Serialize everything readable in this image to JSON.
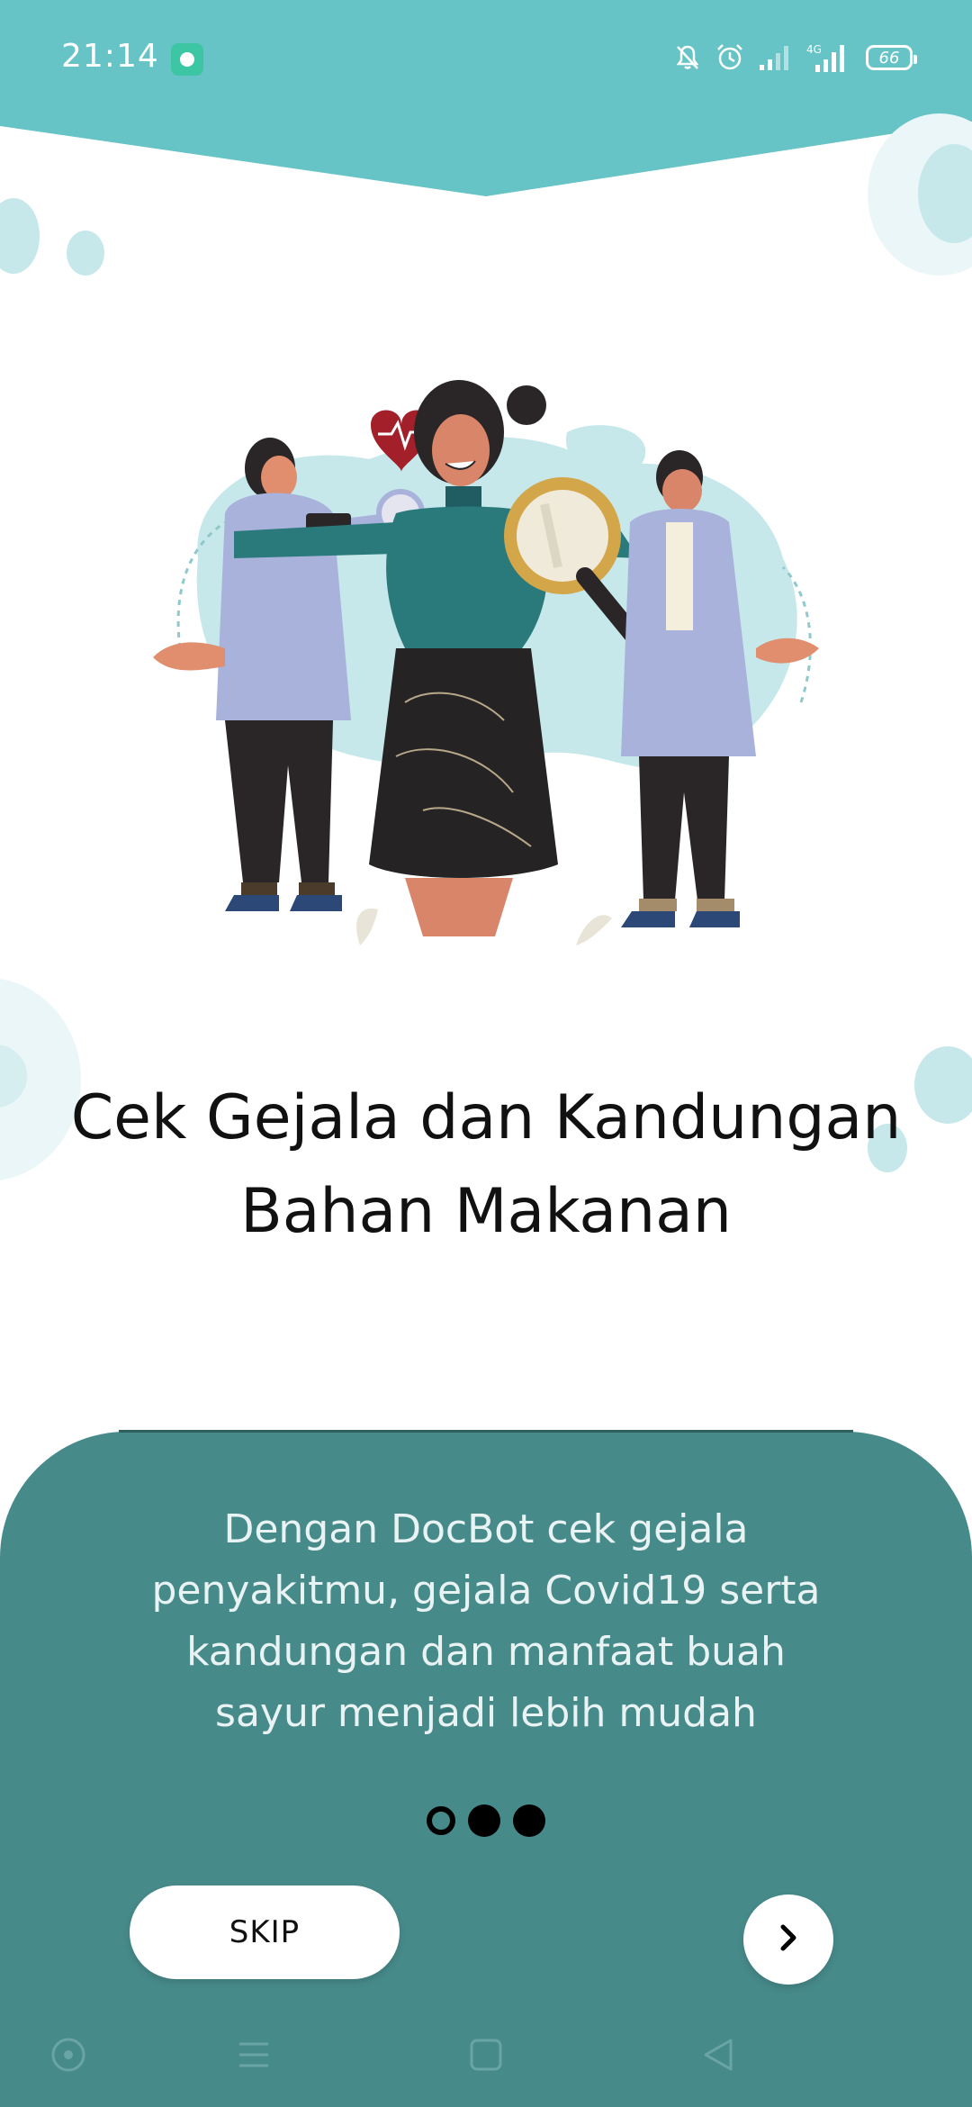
{
  "status_bar": {
    "time": "21:14",
    "battery_level": "66",
    "network_label": "4G",
    "icons": [
      "app-notification-icon",
      "mute-icon",
      "alarm-icon",
      "signal-icon",
      "signal-4g-icon",
      "battery-icon"
    ]
  },
  "onboarding": {
    "headline_line1": "Cek Gejala dan Kandungan",
    "headline_line2": "Bahan Makanan",
    "description_lines": [
      "Dengan DocBot cek gejala",
      "penyakitmu, gejala Covid19 serta",
      "kandungan dan manfaat buah",
      "sayur menjadi lebih mudah"
    ],
    "page_count": 3,
    "current_page": 1
  },
  "buttons": {
    "skip_label": "SKIP",
    "next_icon": "chevron-right-icon"
  },
  "navigation": {
    "items": [
      "assistant-icon",
      "menu-icon",
      "home-square-icon",
      "back-triangle-icon"
    ]
  },
  "colors": {
    "header_teal": "#66c3c6",
    "panel_teal": "#478a8a",
    "bubble_light": "#c6e8ea",
    "text_dark": "#111111"
  }
}
